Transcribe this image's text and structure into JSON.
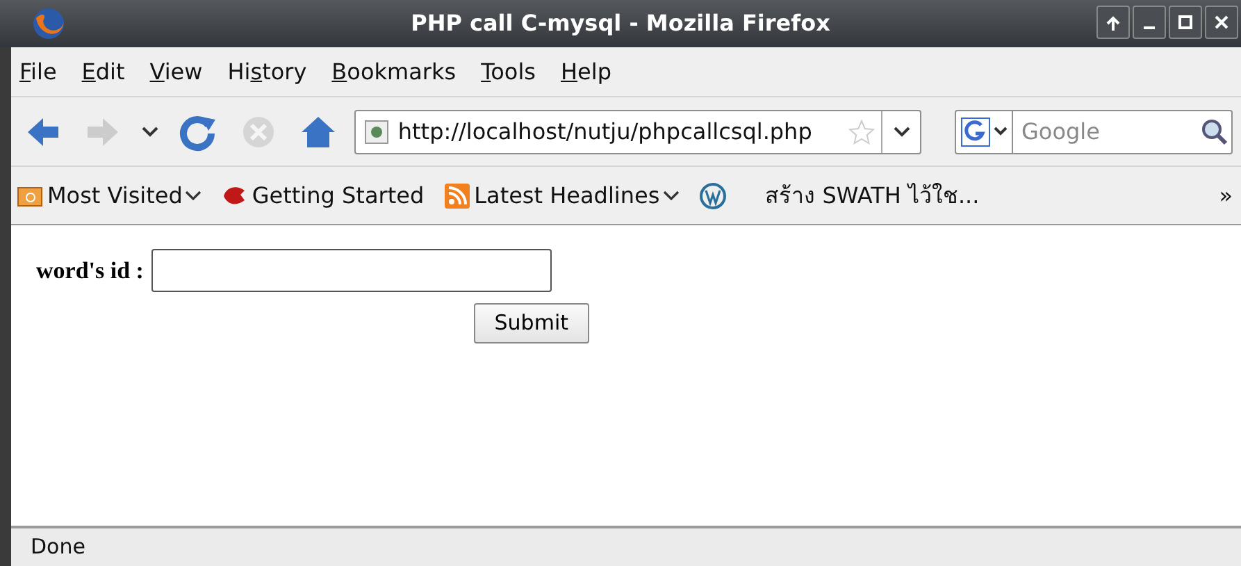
{
  "window": {
    "title": "PHP call C-mysql - Mozilla Firefox"
  },
  "menu": [
    {
      "accel": "F",
      "rest": "ile"
    },
    {
      "accel": "E",
      "rest": "dit"
    },
    {
      "accel": "V",
      "rest": "iew"
    },
    {
      "before": "Hi",
      "accel": "s",
      "rest": "tory"
    },
    {
      "accel": "B",
      "rest": "ookmarks"
    },
    {
      "accel": "T",
      "rest": "ools"
    },
    {
      "accel": "H",
      "rest": "elp"
    }
  ],
  "navigation": {
    "forward_disabled": true,
    "stop_disabled": true,
    "url": "http://localhost/nutju/phpcallcsql.php",
    "search_placeholder": "Google"
  },
  "bookmarks": [
    {
      "kind": "folder",
      "label": "Most Visited",
      "dropdown": true
    },
    {
      "kind": "page",
      "label": "Getting Started",
      "dropdown": false
    },
    {
      "kind": "feed",
      "label": "Latest Headlines",
      "dropdown": true
    },
    {
      "kind": "wordpress",
      "dropdown": false
    },
    {
      "kind": "text",
      "label": "สร้าง SWATH ไว้ใช...",
      "dropdown": false
    }
  ],
  "bookmarks_overflow": "»",
  "form": {
    "label": "word's id :",
    "button": "Submit"
  },
  "status_bar": "Done"
}
